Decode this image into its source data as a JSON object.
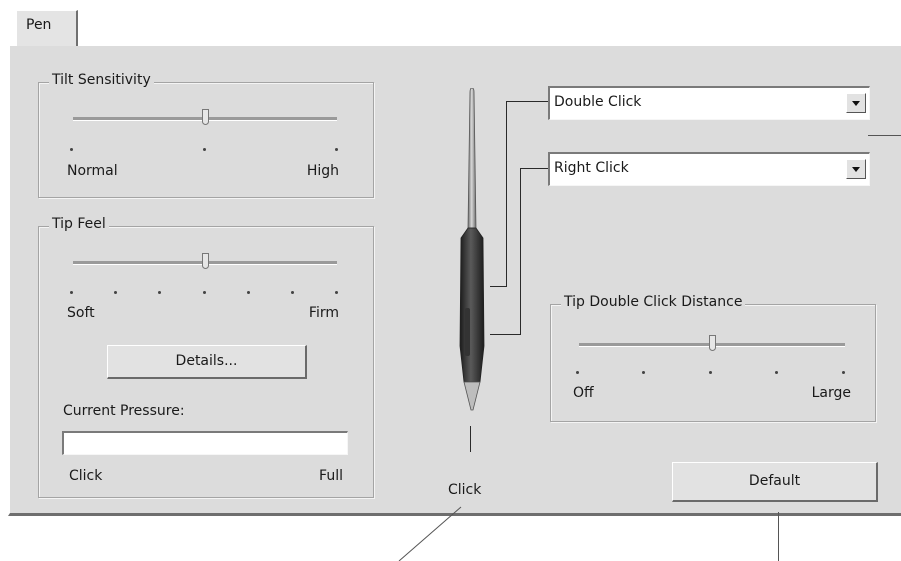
{
  "tab": {
    "label": "Pen"
  },
  "tilt": {
    "legend": "Tilt Sensitivity",
    "min_label": "Normal",
    "max_label": "High",
    "value_fraction": 0.5
  },
  "tip_feel": {
    "legend": "Tip Feel",
    "min_label": "Soft",
    "max_label": "Firm",
    "value_fraction": 0.5,
    "details_button": "Details...",
    "current_pressure_label": "Current Pressure:",
    "pressure_min_label": "Click",
    "pressure_max_label": "Full",
    "pressure_fraction": 0
  },
  "pen": {
    "tip_label": "Click"
  },
  "upper_button": {
    "selected": "Double Click"
  },
  "lower_button": {
    "selected": "Right Click"
  },
  "double_click_distance": {
    "legend": "Tip Double Click Distance",
    "min_label": "Off",
    "max_label": "Large",
    "value_fraction": 0.5
  },
  "default_button": "Default"
}
